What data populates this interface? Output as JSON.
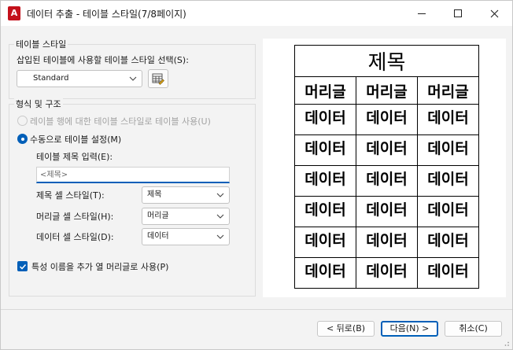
{
  "window": {
    "title": "데이터 추출 - 테이블 스타일(7/8페이지)",
    "app_icon_letter": "A",
    "app_icon_color": "#c4111b"
  },
  "table_style_group": {
    "label": "테이블 스타일",
    "select_label": "삽입된 테이블에 사용할 테이블 스타일 선택(S):",
    "select_value": "Standard",
    "launch_icon": "table-style-dialog-icon"
  },
  "format_group": {
    "label": "형식 및 구조",
    "radio_use_table": {
      "label": "레이블 행에 대한 테이블 스타일로 테이블 사용(U)",
      "enabled": false,
      "checked": false
    },
    "radio_manual": {
      "label": "수동으로 테이블 설정(M)",
      "enabled": true,
      "checked": true
    },
    "title_input_label": "테이블 제목 입력(E):",
    "title_input_placeholder": "<제목>",
    "title_cell_style_label": "제목 셀 스타일(T):",
    "title_cell_style_value": "제목",
    "header_cell_style_label": "머리글 셀 스타일(H):",
    "header_cell_style_value": "머리글",
    "data_cell_style_label": "데이터 셀 스타일(D):",
    "data_cell_style_value": "데이터",
    "checkbox_label": "특성 이름을 추가 열 머리글로 사용(P)",
    "checkbox_checked": true
  },
  "preview": {
    "title": "제목",
    "headers": [
      "머리글",
      "머리글",
      "머리글"
    ],
    "rows": [
      [
        "데이터",
        "데이터",
        "데이터"
      ],
      [
        "데이터",
        "데이터",
        "데이터"
      ],
      [
        "데이터",
        "데이터",
        "데이터"
      ],
      [
        "데이터",
        "데이터",
        "데이터"
      ],
      [
        "데이터",
        "데이터",
        "데이터"
      ],
      [
        "데이터",
        "데이터",
        "데이터"
      ]
    ]
  },
  "buttons": {
    "back": "< 뒤로(B)",
    "next": "다음(N) >",
    "cancel": "취소(C)"
  },
  "colors": {
    "accent": "#005fb8",
    "disabled_text": "#a3a3a3"
  }
}
